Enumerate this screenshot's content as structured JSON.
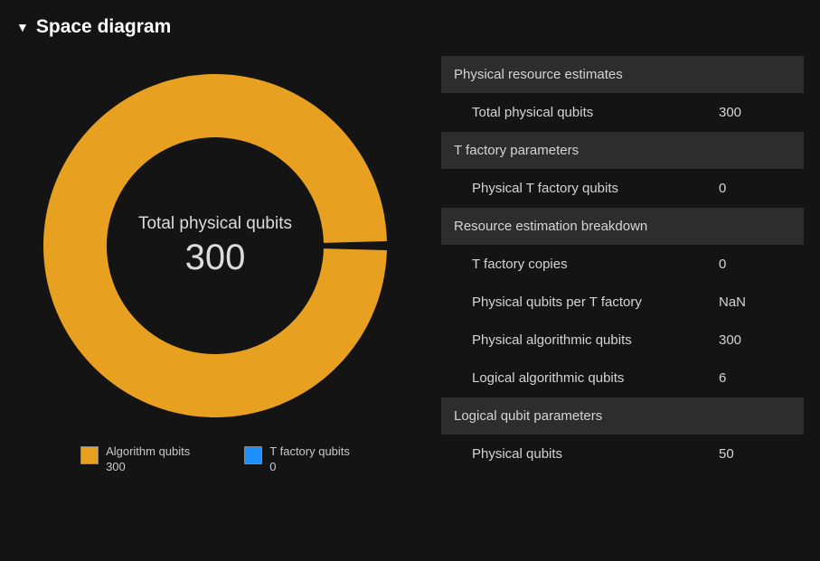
{
  "header": {
    "title": "Space diagram"
  },
  "donut": {
    "center_label": "Total physical qubits",
    "center_value": "300"
  },
  "legend": {
    "items": [
      {
        "label": "Algorithm qubits",
        "value": "300",
        "color": "#e8a020"
      },
      {
        "label": "T factory qubits",
        "value": "0",
        "color": "#1f8fff"
      }
    ]
  },
  "colors": {
    "algorithm": "#e8a020",
    "tfactory": "#1f8fff"
  },
  "table": {
    "sections": [
      {
        "header": "Physical resource estimates",
        "rows": [
          {
            "label": "Total physical qubits",
            "value": "300"
          }
        ]
      },
      {
        "header": "T factory parameters",
        "rows": [
          {
            "label": "Physical T factory qubits",
            "value": "0"
          }
        ]
      },
      {
        "header": "Resource estimation breakdown",
        "rows": [
          {
            "label": "T factory copies",
            "value": "0"
          },
          {
            "label": "Physical qubits per T factory",
            "value": "NaN"
          },
          {
            "label": "Physical algorithmic qubits",
            "value": "300"
          },
          {
            "label": "Logical algorithmic qubits",
            "value": "6"
          }
        ]
      },
      {
        "header": "Logical qubit parameters",
        "rows": [
          {
            "label": "Physical qubits",
            "value": "50"
          }
        ]
      }
    ]
  },
  "chart_data": {
    "type": "pie",
    "title": "Total physical qubits",
    "total": 300,
    "series": [
      {
        "name": "Algorithm qubits",
        "value": 300,
        "color": "#e8a020"
      },
      {
        "name": "T factory qubits",
        "value": 0,
        "color": "#1f8fff"
      }
    ]
  }
}
